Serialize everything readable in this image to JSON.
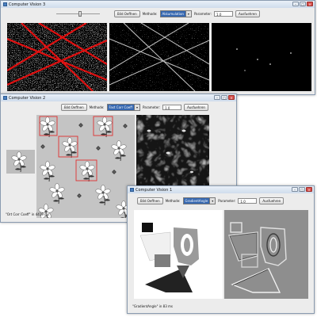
{
  "window1": {
    "title": "Computer Vision 3",
    "toolbar": {
      "slider_value": 0.55,
      "button_label": "Bild Oeffnen",
      "method_label": "Methode:",
      "method_value": "Akkumulation",
      "parameter_label": "Parameter:",
      "parameter_value": "1.0",
      "run_label": "Ausfuehren"
    }
  },
  "window2": {
    "title": "Computer Vision 2",
    "toolbar": {
      "button_label": "Bild Oeffnen",
      "method_label": "Methode:",
      "method_value": "Fast Corr Coeff",
      "parameter_label": "Parameter:",
      "parameter_value": "1.0",
      "run_label": "Ausfuehren"
    },
    "status": "\"Ort Corr Coeff\" in 4419 ms"
  },
  "window3": {
    "title": "Computer Vision 1",
    "toolbar": {
      "button_label": "Bild Oeffnen",
      "method_label": "Methode:",
      "method_value": "GradientAngle",
      "parameter_label": "Parameter:",
      "parameter_value": "1.0",
      "run_label": "Ausfuehren"
    },
    "status": "\"GradientAngle\" in 83 ms"
  },
  "colors": {
    "titlebar": "#dbe6f4",
    "match_box": "#e03030",
    "hough_line": "#e01010"
  }
}
